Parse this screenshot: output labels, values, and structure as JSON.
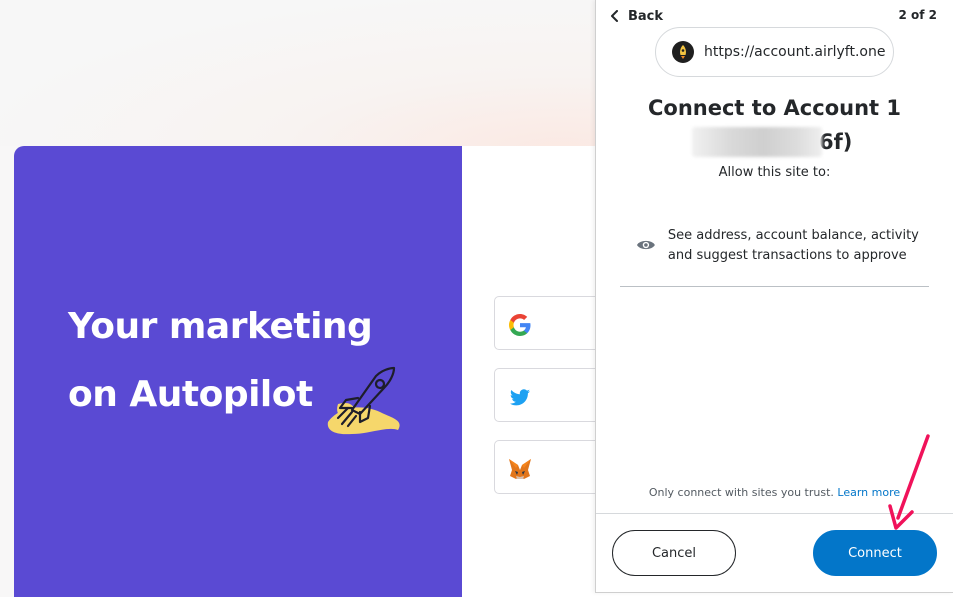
{
  "background_page": {
    "hero": {
      "line1": "Your marketing",
      "line2": "on Autopilot",
      "color": "#5a4ad3"
    },
    "login_options": [
      {
        "icon": "google-icon"
      },
      {
        "icon": "twitter-icon"
      },
      {
        "icon": "metamask-fox-icon"
      }
    ]
  },
  "popup": {
    "back_label": "Back",
    "step": "2 of 2",
    "site_url": "https://account.airlyft.one",
    "title": "Connect to Account 1",
    "address_suffix": "6f)",
    "allow_text": "Allow this site to:",
    "permission": "See address, account balance, activity and suggest transactions to approve",
    "trust_text": "Only connect with sites you trust.",
    "learn_more": "Learn more",
    "cancel_label": "Cancel",
    "connect_label": "Connect",
    "accent_color": "#0376c9"
  },
  "annotation": {
    "arrow_color": "#f0125a"
  }
}
